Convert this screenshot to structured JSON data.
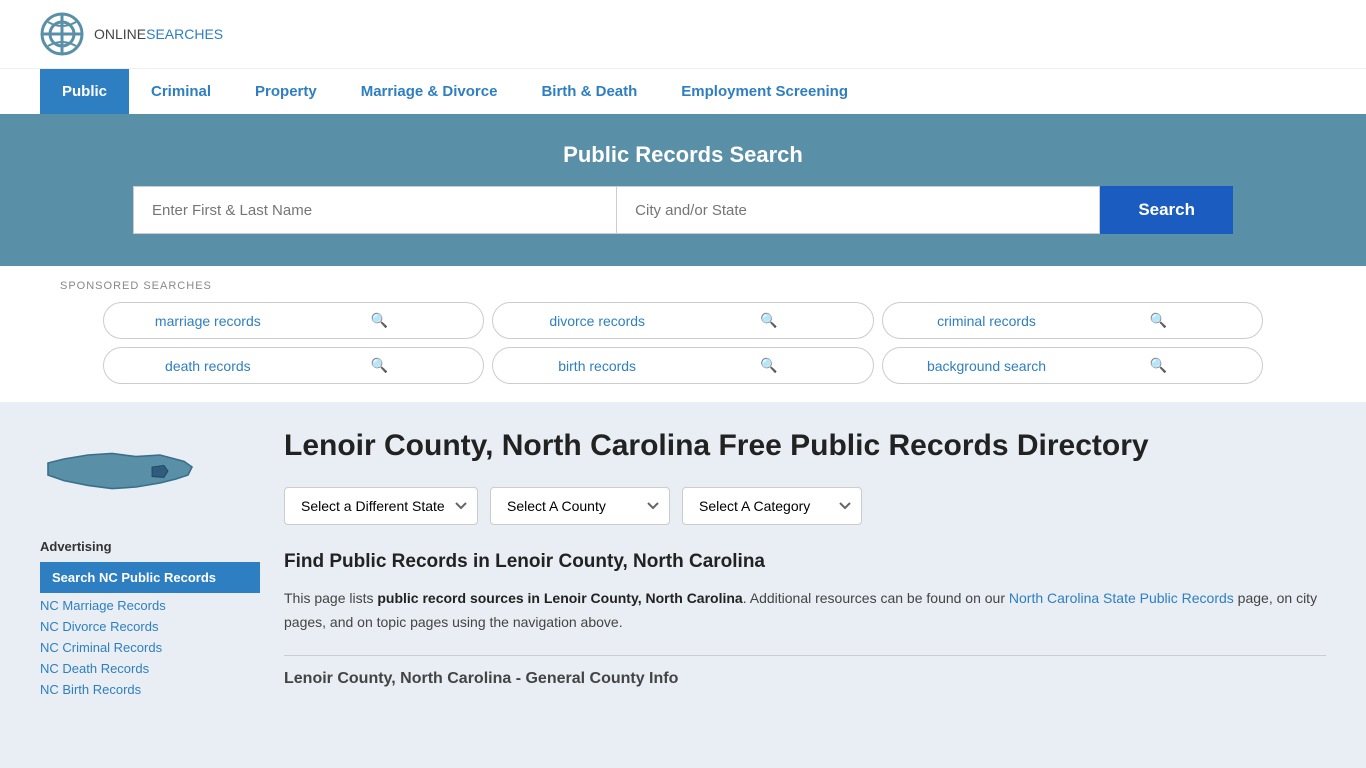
{
  "logo": {
    "online": "ONLINE",
    "searches": "SEARCHES"
  },
  "nav": {
    "items": [
      {
        "label": "Public",
        "active": true
      },
      {
        "label": "Criminal",
        "active": false
      },
      {
        "label": "Property",
        "active": false
      },
      {
        "label": "Marriage & Divorce",
        "active": false
      },
      {
        "label": "Birth & Death",
        "active": false
      },
      {
        "label": "Employment Screening",
        "active": false
      }
    ]
  },
  "hero": {
    "title": "Public Records Search",
    "name_placeholder": "Enter First & Last Name",
    "location_placeholder": "City and/or State",
    "search_button": "Search"
  },
  "sponsored": {
    "label": "SPONSORED SEARCHES",
    "items": [
      {
        "text": "marriage records"
      },
      {
        "text": "divorce records"
      },
      {
        "text": "criminal records"
      },
      {
        "text": "death records"
      },
      {
        "text": "birth records"
      },
      {
        "text": "background search"
      }
    ]
  },
  "sidebar": {
    "ad_label": "Advertising",
    "ad_item": "Search NC Public Records",
    "links": [
      "NC Marriage Records",
      "NC Divorce Records",
      "NC Criminal Records",
      "NC Death Records",
      "NC Birth Records"
    ]
  },
  "main": {
    "page_title": "Lenoir County, North Carolina Free Public Records Directory",
    "dropdowns": {
      "state": "Select a Different State",
      "county": "Select A County",
      "category": "Select A Category"
    },
    "find_title": "Find Public Records in Lenoir County, North Carolina",
    "body_intro": "This page lists ",
    "body_bold": "public record sources in Lenoir County, North Carolina",
    "body_middle": ". Additional resources can be found on our ",
    "body_link": "North Carolina State Public Records",
    "body_end": " page, on city pages, and on topic pages using the navigation above.",
    "section_subheader": "Lenoir County, North Carolina - General County Info"
  }
}
